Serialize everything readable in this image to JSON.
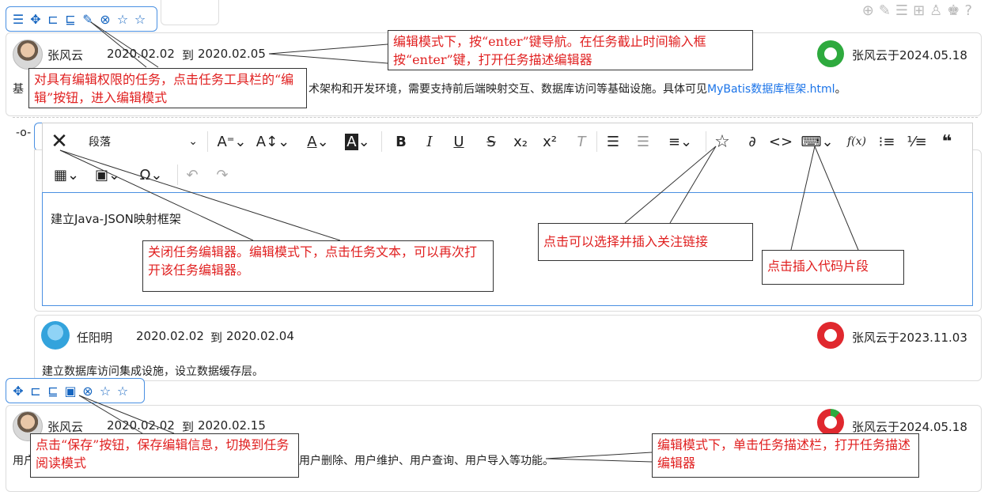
{
  "top_right_icons": [
    "plus-circle-icon",
    "edit-icon",
    "expand-icon",
    "tree-icon",
    "person-icon",
    "people-icon",
    "help-icon"
  ],
  "tasks": [
    {
      "owner": "张风云",
      "start_date": "2020.02.02",
      "date_sep": "到",
      "end_date": "2020.02.05",
      "status_text": "张风云于2024.05.18",
      "ring_color": "#2eaa3e",
      "desc_prefix": "基",
      "desc_mid": "术架构和开发环境，需要支持前后端映射交互、数据库访问等基础设施。具体可见",
      "desc_link": "MyBatis数据库框架.html",
      "desc_suffix": "。"
    },
    {
      "owner": "任阳明",
      "start_date": "2020.02.02",
      "date_sep": "到",
      "end_date": "2020.02.04",
      "status_text": "张风云于2023.11.03",
      "ring_color": "#e0282e",
      "desc": "建立数据库访问集成设施，设立数据缓存层。"
    },
    {
      "owner": "张风云",
      "start_date": "2020.02.02",
      "date_sep": "到",
      "end_date": "2020.02.15",
      "status_text": "张风云于2024.05.18",
      "ring_color": "#e0282e",
      "desc_prefix": "用户",
      "desc_suffix": "用户删除、用户维护、用户查询、用户导入等功能。"
    }
  ],
  "editor": {
    "paragraph_select": "段落",
    "content": "建立Java-JSON映射框架",
    "formula_label": "f(x)"
  },
  "callouts": {
    "edit_permission": "对具有编辑权限的任务，点击任务工具栏的“编辑”按钮，进入编辑模式",
    "enter_nav": "编辑模式下，按“enter”键导航。在任务截止时间输入框按“enter”键，打开任务描述编辑器",
    "close_editor": "关闭任务编辑器。编辑模式下，点击任务文本，可以再次打开该任务编辑器。",
    "insert_link": "点击可以选择并插入关注链接",
    "insert_code": "点击插入代码片段",
    "save": "点击“保存”按钮，保存编辑信息，切换到任务阅读模式",
    "desc_editor": "编辑模式下，单击任务描述栏，打开任务描述编辑器"
  }
}
